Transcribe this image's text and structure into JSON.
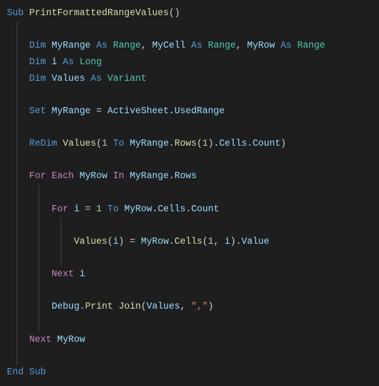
{
  "code": {
    "sub_kw": "Sub",
    "sub_name": "PrintFormattedRangeValues",
    "sub_parens": "()",
    "dim_kw": "Dim",
    "as_kw": "As",
    "set_kw": "Set",
    "redim_kw": "ReDim",
    "for_kw": "For",
    "each_kw": "Each",
    "in_kw": "In",
    "to_kw": "To",
    "next_kw": "Next",
    "end_sub_kw": "End Sub",
    "var_myrange": "MyRange",
    "var_mycell": "MyCell",
    "var_myrow": "MyRow",
    "var_i": "i",
    "var_values": "Values",
    "type_range": "Range",
    "type_long": "Long",
    "type_variant": "Variant",
    "obj_activesheet": "ActiveSheet",
    "prop_usedrange": "UsedRange",
    "prop_rows": "Rows",
    "prop_cells": "Cells",
    "prop_count": "Count",
    "prop_value": "Value",
    "obj_debug": "Debug",
    "fn_print": "Print",
    "fn_join": "Join",
    "num_one": "1",
    "str_comma": "\",\"",
    "eq": " = ",
    "comma_sp": ", ",
    "dot": ".",
    "lparen": "(",
    "rparen": ")"
  }
}
